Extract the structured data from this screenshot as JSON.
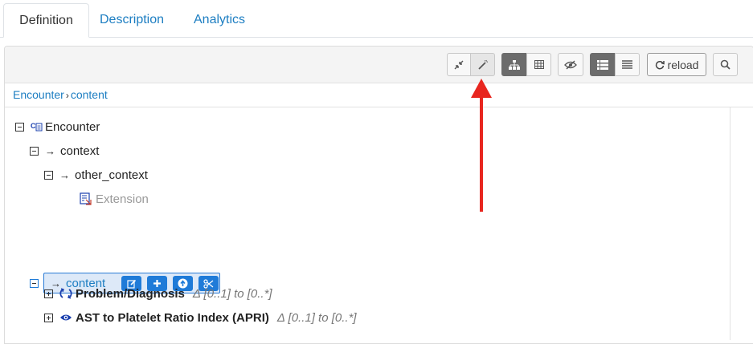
{
  "tabs": [
    {
      "label": "Definition",
      "active": true
    },
    {
      "label": "Description",
      "active": false
    },
    {
      "label": "Analytics",
      "active": false
    }
  ],
  "toolbar": {
    "buttons": [
      {
        "icon": "collapse-arrows-icon"
      },
      {
        "icon": "magic-wand-icon"
      },
      {
        "icon": "hierarchy-icon",
        "active": true
      },
      {
        "icon": "table-icon"
      },
      {
        "icon": "eye-slash-icon"
      },
      {
        "icon": "list-icon",
        "active": true
      },
      {
        "icon": "lines-icon"
      },
      {
        "icon": "search-icon"
      }
    ],
    "reload_label": "reload"
  },
  "breadcrumb": {
    "items": [
      "Encounter",
      "content"
    ],
    "separator": "›"
  },
  "tree": {
    "root": {
      "label": "Encounter",
      "icon": "class-icon"
    },
    "context": {
      "label": "context"
    },
    "other_context": {
      "label": "other_context"
    },
    "extension": {
      "label": "Extension",
      "icon": "extension-icon"
    },
    "content": {
      "label": "content",
      "actions": [
        "edit-icon",
        "plus-icon",
        "upload-icon",
        "cut-icon"
      ]
    },
    "problem": {
      "label": "Problem/Diagnosis",
      "cardinality": "Δ [0..1] to [0..*]",
      "icon": "cycle-icon"
    },
    "apri": {
      "label": "AST to Platelet Ratio Index (APRI)",
      "cardinality": "Δ [0..1] to [0..*]",
      "icon": "eye-icon"
    }
  },
  "colors": {
    "accent": "#1d7ec2",
    "selection": "#dde9f8",
    "annotation_arrow": "#e8261f"
  }
}
